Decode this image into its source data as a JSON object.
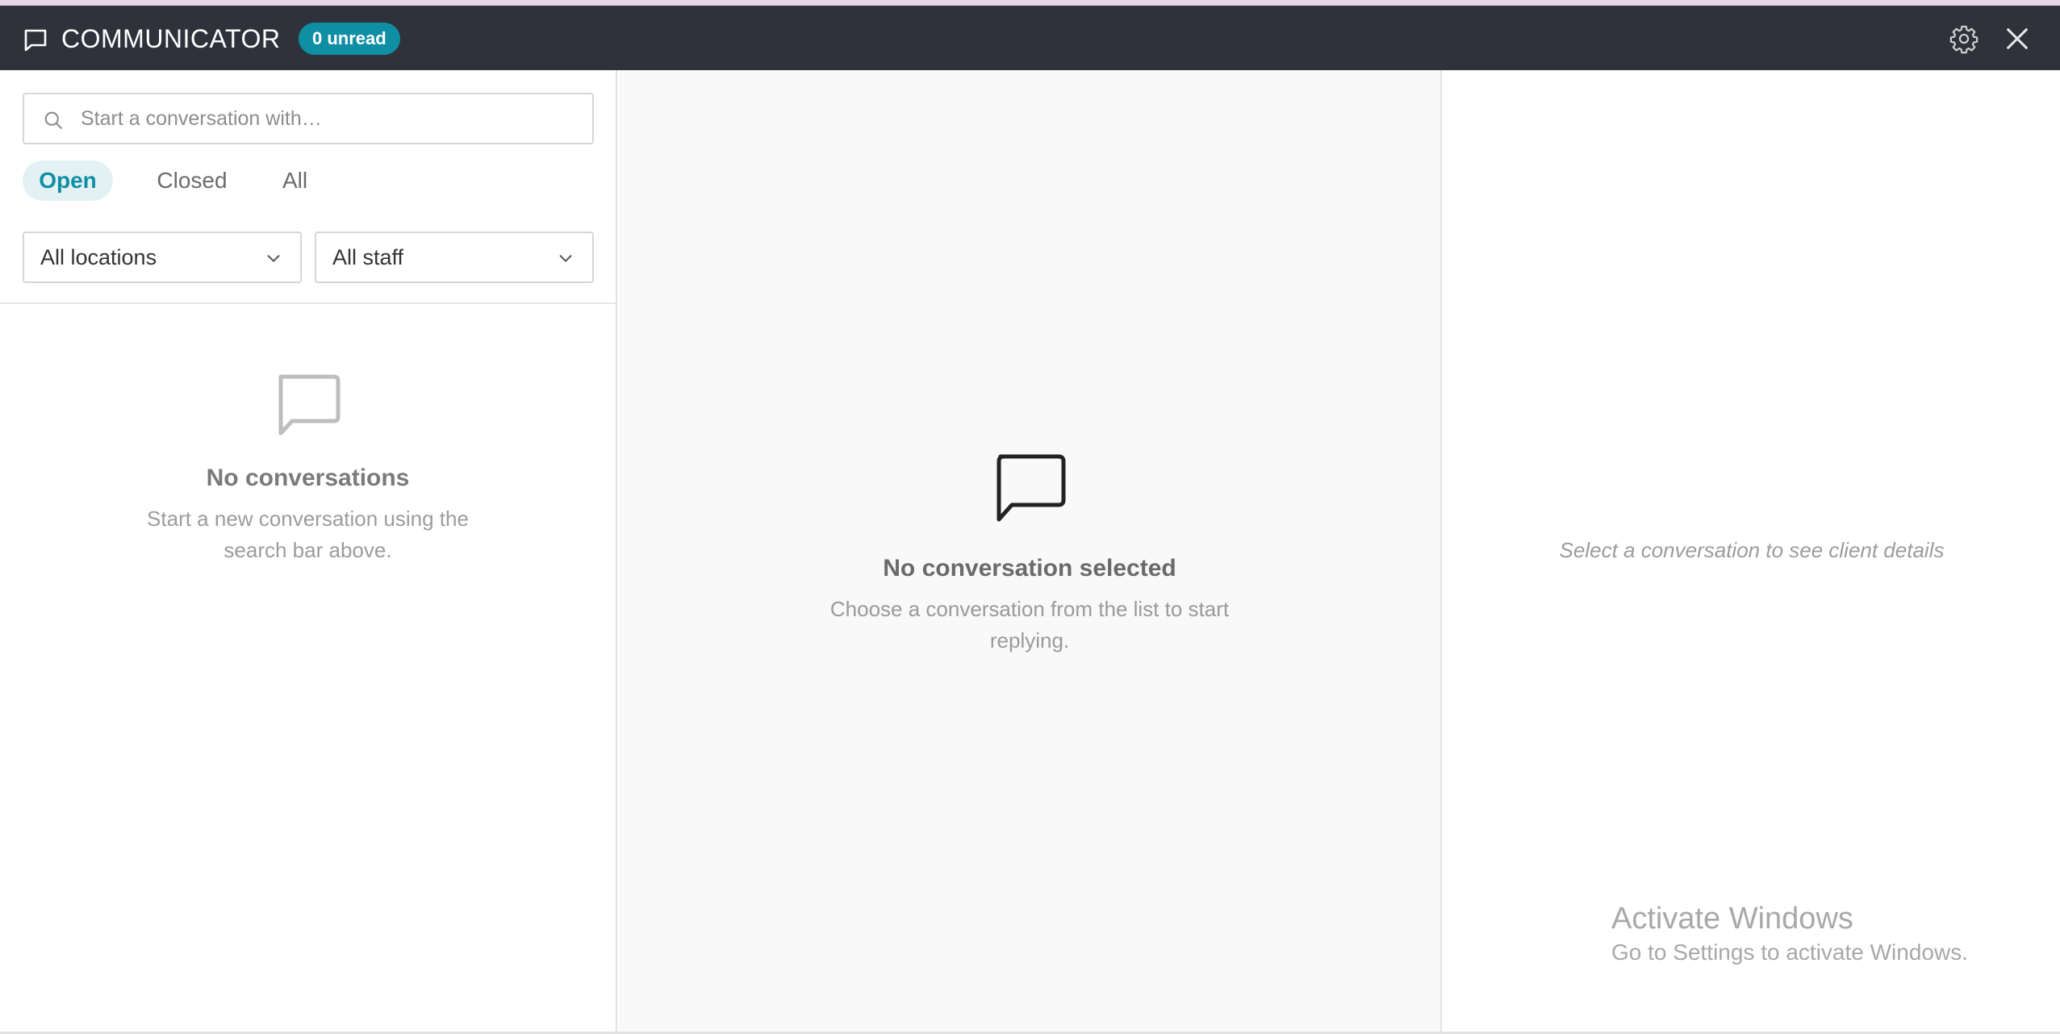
{
  "header": {
    "title": "COMMUNICATOR",
    "unread_badge": "0 unread",
    "icons": {
      "app": "chat-bubble-icon",
      "settings": "gear-icon",
      "close": "close-icon"
    }
  },
  "sidebar": {
    "search": {
      "placeholder": "Start a conversation with…",
      "value": ""
    },
    "tabs": [
      {
        "label": "Open",
        "active": true
      },
      {
        "label": "Closed",
        "active": false
      },
      {
        "label": "All",
        "active": false
      }
    ],
    "filters": {
      "location": "All locations",
      "staff": "All staff"
    },
    "empty_state": {
      "title": "No conversations",
      "message": "Start a new conversation using the search bar above."
    }
  },
  "main": {
    "empty_state": {
      "title": "No conversation selected",
      "message": "Choose a conversation from the list to start replying."
    }
  },
  "details": {
    "hint": "Select a conversation to see client details"
  },
  "os_watermark": {
    "line1": "Activate Windows",
    "line2": "Go to Settings to activate Windows."
  },
  "colors": {
    "header_bg": "#2f323b",
    "accent": "#0f8fa3",
    "tab_active_bg": "#e3f1f4"
  }
}
